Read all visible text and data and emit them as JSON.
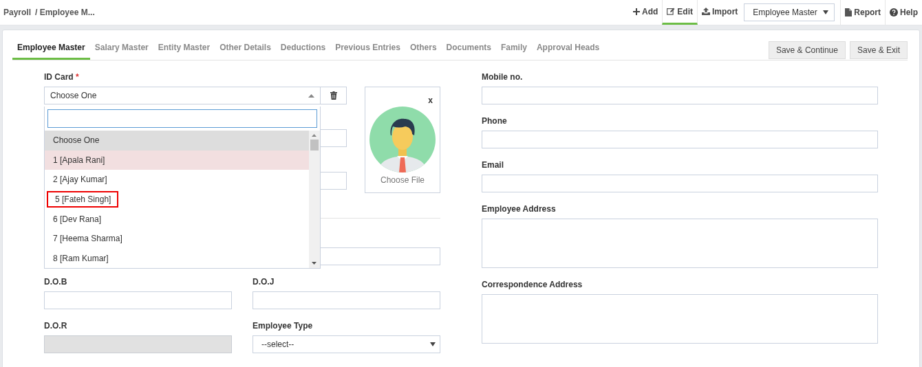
{
  "breadcrumb": {
    "root": "Payroll",
    "current": "/ Employee M..."
  },
  "toolbar": {
    "actions": [
      {
        "label": "Add",
        "kind": "plus",
        "selected": false
      },
      {
        "label": "Edit",
        "kind": "edit",
        "selected": true
      },
      {
        "label": "Import",
        "kind": "upload",
        "selected": false
      }
    ],
    "master_select": {
      "value": "Employee Master"
    },
    "links": [
      {
        "label": "Report",
        "kind": "file"
      },
      {
        "label": "Help",
        "kind": "help"
      }
    ]
  },
  "tabs": [
    {
      "label": "Employee Master",
      "selected": true
    },
    {
      "label": "Salary Master",
      "selected": false
    },
    {
      "label": "Entity Master",
      "selected": false
    },
    {
      "label": "Other Details",
      "selected": false
    },
    {
      "label": "Deductions",
      "selected": false
    },
    {
      "label": "Previous Entries",
      "selected": false
    },
    {
      "label": "Others",
      "selected": false
    },
    {
      "label": "Documents",
      "selected": false
    },
    {
      "label": "Family",
      "selected": false
    },
    {
      "label": "Approval Heads",
      "selected": false
    }
  ],
  "buttons": [
    "Save & Continue",
    "Save & Exit"
  ],
  "id_card": {
    "label": "ID Card",
    "required_mark": "*",
    "value": "Choose One",
    "expanded": true,
    "options": [
      {
        "label": "Choose One",
        "selected": true,
        "hovered": false,
        "outlined": false
      },
      {
        "label": "1 [Apala Rani]",
        "selected": false,
        "hovered": true,
        "outlined": false
      },
      {
        "label": "2 [Ajay Kumar]",
        "selected": false,
        "hovered": false,
        "outlined": false
      },
      {
        "label": "5 [Fateh Singh]",
        "selected": false,
        "hovered": false,
        "outlined": true
      },
      {
        "label": "6 [Dev Rana]",
        "selected": false,
        "hovered": false,
        "outlined": false
      },
      {
        "label": "7 [Heema Sharma]",
        "selected": false,
        "hovered": false,
        "outlined": false
      },
      {
        "label": "8 [Ram Kumar]",
        "selected": false,
        "hovered": false,
        "outlined": false
      }
    ]
  },
  "photo": {
    "close": "x",
    "action": "Choose File"
  },
  "left_fields": [
    {
      "label": "D.O.B",
      "kind": "input",
      "disabled": false
    },
    {
      "label": "D.O.J",
      "kind": "input",
      "disabled": false
    },
    {
      "label": "D.O.R",
      "kind": "input",
      "disabled": true
    },
    {
      "label": "Employee Type",
      "kind": "select",
      "value": "--select--",
      "disabled": false
    }
  ],
  "right_fields": [
    {
      "label": "Mobile no.",
      "kind": "input"
    },
    {
      "label": "Phone",
      "kind": "input"
    },
    {
      "label": "Email",
      "kind": "input"
    },
    {
      "label": "Employee Address",
      "kind": "textarea"
    },
    {
      "label": "Correspondence Address",
      "kind": "textarea"
    }
  ]
}
